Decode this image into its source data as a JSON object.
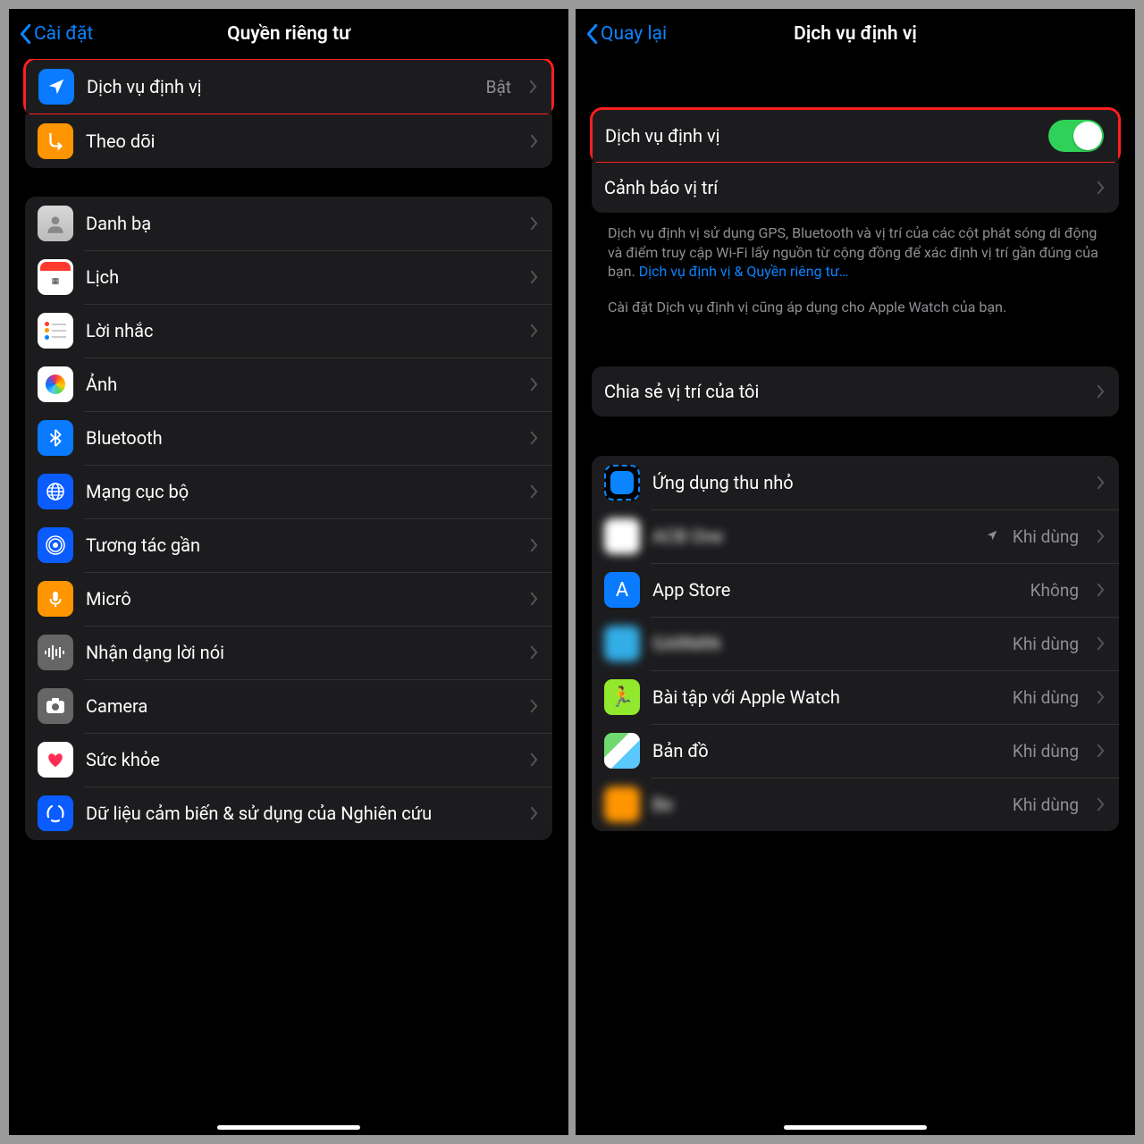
{
  "left": {
    "back": "Cài đặt",
    "title": "Quyền riêng tư",
    "group1": [
      {
        "label": "Dịch vụ định vị",
        "value": "Bật",
        "icon": "location-arrow",
        "bg": "ic-blue",
        "highlight": true
      },
      {
        "label": "Theo dõi",
        "icon": "tracking",
        "bg": "ic-orange"
      }
    ],
    "group2": [
      {
        "label": "Danh bạ",
        "icon": "contacts",
        "bg": "ic-contacts"
      },
      {
        "label": "Lịch",
        "icon": "calendar",
        "bg": "ic-white"
      },
      {
        "label": "Lời nhắc",
        "icon": "reminders",
        "bg": "ic-white"
      },
      {
        "label": "Ảnh",
        "icon": "photos",
        "bg": "ic-photos"
      },
      {
        "label": "Bluetooth",
        "icon": "bluetooth",
        "bg": "ic-blue"
      },
      {
        "label": "Mạng cục bộ",
        "icon": "globe",
        "bg": "ic-darkblue"
      },
      {
        "label": "Tương tác gần",
        "icon": "nearby",
        "bg": "ic-darkblue"
      },
      {
        "label": "Micrô",
        "icon": "mic",
        "bg": "ic-orange"
      },
      {
        "label": "Nhận dạng lời nói",
        "icon": "waveform",
        "bg": "ic-gray"
      },
      {
        "label": "Camera",
        "icon": "camera",
        "bg": "ic-gray"
      },
      {
        "label": "Sức khỏe",
        "icon": "health",
        "bg": "ic-white"
      },
      {
        "label": "Dữ liệu cảm biến & sử dụng của Nghiên cứu",
        "icon": "research",
        "bg": "ic-darkblue"
      }
    ]
  },
  "right": {
    "back": "Quay lại",
    "title": "Dịch vụ định vị",
    "toggle_label": "Dịch vụ định vị",
    "alerts_label": "Cảnh báo vị trí",
    "desc1": "Dịch vụ định vị sử dụng GPS, Bluetooth và vị trí của các cột phát sóng di động và điểm truy cập Wi-Fi lấy nguồn từ cộng đồng để xác định vị trí gần đúng của bạn. ",
    "desc1_link": "Dịch vụ định vị & Quyền riêng tư…",
    "desc2": "Cài đặt Dịch vụ định vị cũng áp dụng cho Apple Watch của bạn.",
    "share_label": "Chia sẻ vị trí của tôi",
    "apps": [
      {
        "label": "Ứng dụng thu nhỏ",
        "value": "",
        "appclip": true
      },
      {
        "label": "ACB One",
        "value": "Khi dùng",
        "blur": true,
        "arrow": true,
        "bg": "ic-white"
      },
      {
        "label": "App Store",
        "value": "Không",
        "bg": "ic-blue",
        "glyph": "A"
      },
      {
        "label": "GARMIN",
        "value": "Khi dùng",
        "blur": true,
        "bg": "ic-teal"
      },
      {
        "label": "Bài tập với Apple Watch",
        "value": "Khi dùng",
        "bg": "ic-green",
        "glyph": "🏃"
      },
      {
        "label": "Bản đồ",
        "value": "Khi dùng",
        "maps": true
      },
      {
        "label": "Be",
        "value": "Khi dùng",
        "blur": true,
        "bg": "ic-orange"
      }
    ]
  }
}
